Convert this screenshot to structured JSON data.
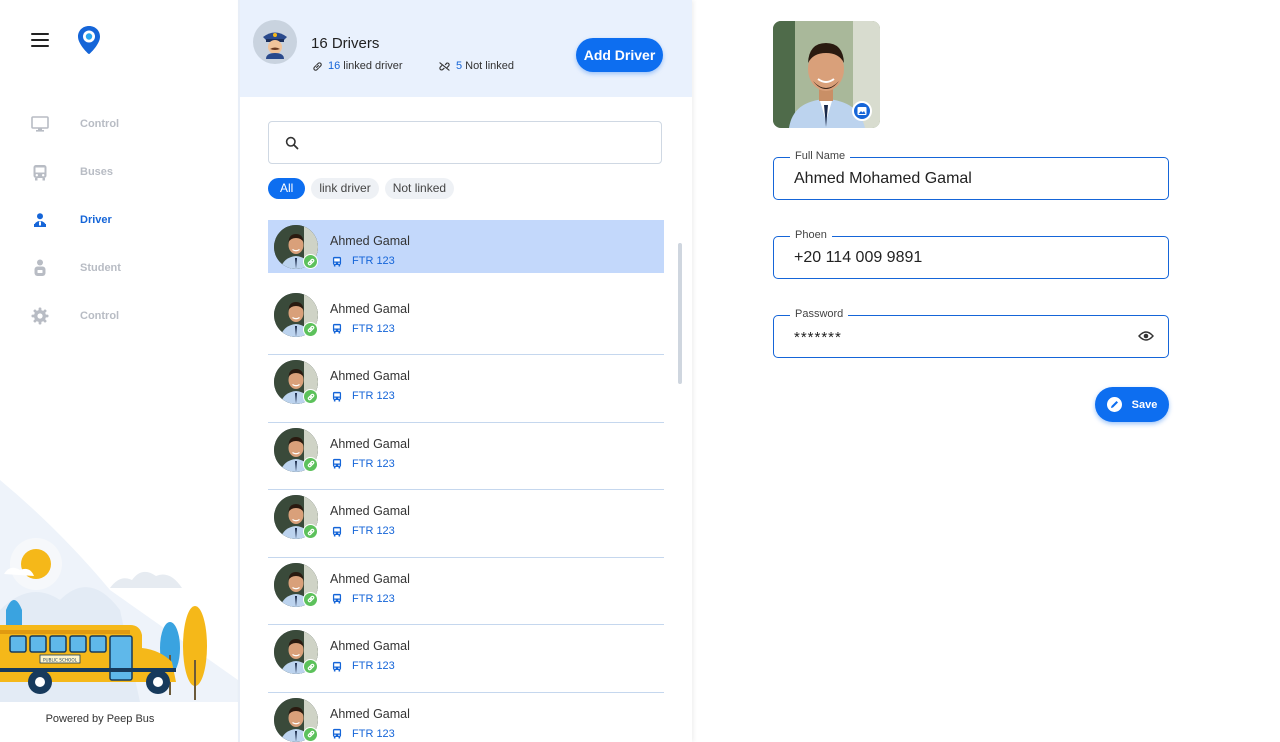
{
  "sidebar": {
    "items": [
      {
        "label": "Control",
        "icon": "monitor-icon",
        "active": false
      },
      {
        "label": "Buses",
        "icon": "bus-icon",
        "active": false
      },
      {
        "label": "Driver",
        "icon": "driver-icon",
        "active": true
      },
      {
        "label": "Student",
        "icon": "student-icon",
        "active": false
      },
      {
        "label": "Control",
        "icon": "gear-icon",
        "active": false
      }
    ],
    "powered_by": "Powered by Peep Bus",
    "bus_sign": "PUBLIC SCHOOL"
  },
  "list_panel": {
    "count_label": "16 Drivers",
    "linked": {
      "count": "16",
      "label": "linked driver"
    },
    "not_linked": {
      "count": "5",
      "label": "Not linked"
    },
    "add_button": "Add Driver",
    "search": {
      "placeholder": "",
      "value": ""
    },
    "filters": [
      {
        "label": "All",
        "active": true
      },
      {
        "label": "link driver",
        "active": false
      },
      {
        "label": "Not linked",
        "active": false
      }
    ],
    "drivers": [
      {
        "name": "Ahmed Gamal",
        "bus": "FTR 123",
        "selected": true
      },
      {
        "name": "Ahmed Gamal",
        "bus": "FTR 123",
        "selected": false
      },
      {
        "name": "Ahmed Gamal",
        "bus": "FTR 123",
        "selected": false
      },
      {
        "name": "Ahmed Gamal",
        "bus": "FTR 123",
        "selected": false
      },
      {
        "name": "Ahmed Gamal",
        "bus": "FTR 123",
        "selected": false
      },
      {
        "name": "Ahmed Gamal",
        "bus": "FTR 123",
        "selected": false
      },
      {
        "name": "Ahmed Gamal",
        "bus": "FTR 123",
        "selected": false
      },
      {
        "name": "Ahmed Gamal",
        "bus": "FTR 123",
        "selected": false
      }
    ]
  },
  "form": {
    "full_name": {
      "label": "Full Name",
      "value": "Ahmed Mohamed Gamal"
    },
    "phone": {
      "label": "Phoen",
      "value": "+20 114 009 9891"
    },
    "password": {
      "label": "Password",
      "value": "*******"
    },
    "save_label": "Save"
  },
  "colors": {
    "accent": "#0d6ef0",
    "link_badge": "#5cc15b",
    "selected_row": "#c3d8fb",
    "header_bg": "#e9f1fd"
  }
}
